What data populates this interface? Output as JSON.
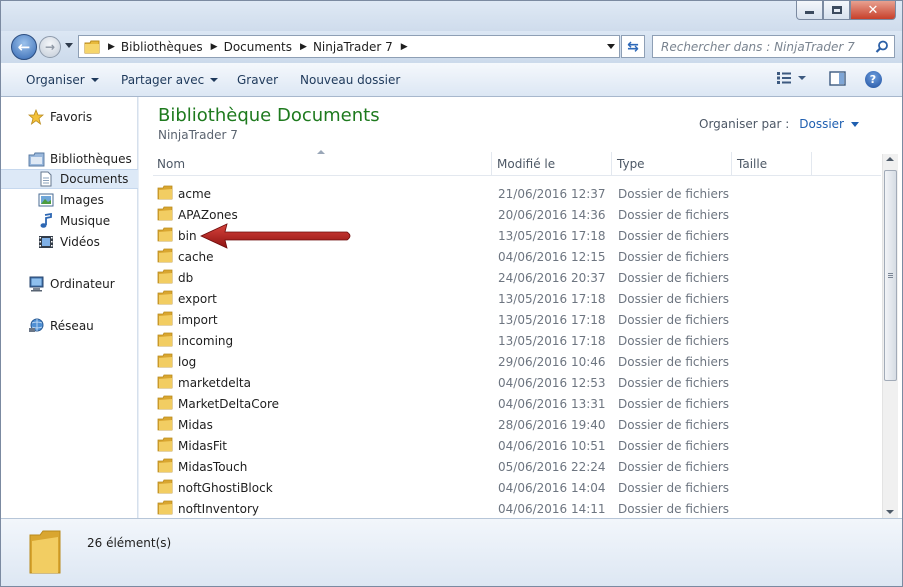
{
  "address": {
    "crumbs": [
      "Bibliothèques",
      "Documents",
      "NinjaTrader 7"
    ]
  },
  "search": {
    "placeholder": "Rechercher dans : NinjaTrader 7"
  },
  "toolbar": {
    "organize": "Organiser",
    "share": "Partager avec",
    "burn": "Graver",
    "new_folder": "Nouveau dossier"
  },
  "nav": {
    "favorites": "Favoris",
    "libraries": "Bibliothèques",
    "documents": "Documents",
    "images": "Images",
    "music": "Musique",
    "videos": "Vidéos",
    "computer": "Ordinateur",
    "network": "Réseau"
  },
  "library": {
    "title": "Bibliothèque Documents",
    "subtitle": "NinjaTrader 7",
    "arrange_label": "Organiser par :",
    "arrange_value": "Dossier"
  },
  "columns": {
    "name": "Nom",
    "modified": "Modifié le",
    "type": "Type",
    "size": "Taille"
  },
  "rows": [
    {
      "name": "acme",
      "date": "21/06/2016 12:37",
      "type": "Dossier de fichiers"
    },
    {
      "name": "APAZones",
      "date": "20/06/2016 14:36",
      "type": "Dossier de fichiers"
    },
    {
      "name": "bin",
      "date": "13/05/2016 17:18",
      "type": "Dossier de fichiers"
    },
    {
      "name": "cache",
      "date": "04/06/2016 12:15",
      "type": "Dossier de fichiers"
    },
    {
      "name": "db",
      "date": "24/06/2016 20:37",
      "type": "Dossier de fichiers"
    },
    {
      "name": "export",
      "date": "13/05/2016 17:18",
      "type": "Dossier de fichiers"
    },
    {
      "name": "import",
      "date": "13/05/2016 17:18",
      "type": "Dossier de fichiers"
    },
    {
      "name": "incoming",
      "date": "13/05/2016 17:18",
      "type": "Dossier de fichiers"
    },
    {
      "name": "log",
      "date": "29/06/2016 10:46",
      "type": "Dossier de fichiers"
    },
    {
      "name": "marketdelta",
      "date": "04/06/2016 12:53",
      "type": "Dossier de fichiers"
    },
    {
      "name": "MarketDeltaCore",
      "date": "04/06/2016 13:31",
      "type": "Dossier de fichiers"
    },
    {
      "name": "Midas",
      "date": "28/06/2016 19:40",
      "type": "Dossier de fichiers"
    },
    {
      "name": "MidasFit",
      "date": "04/06/2016 10:51",
      "type": "Dossier de fichiers"
    },
    {
      "name": "MidasTouch",
      "date": "05/06/2016 22:24",
      "type": "Dossier de fichiers"
    },
    {
      "name": "noftGhostiBlock",
      "date": "04/06/2016 14:04",
      "type": "Dossier de fichiers"
    },
    {
      "name": "noftInventory",
      "date": "04/06/2016 14:11",
      "type": "Dossier de fichiers"
    }
  ],
  "status": {
    "count": "26 élément(s)"
  },
  "colors": {
    "title_green": "#1e7a1e",
    "link_blue": "#1f5fb0",
    "arrow_red": "#b01c1c",
    "folder_yellow": "#e8b93c"
  }
}
